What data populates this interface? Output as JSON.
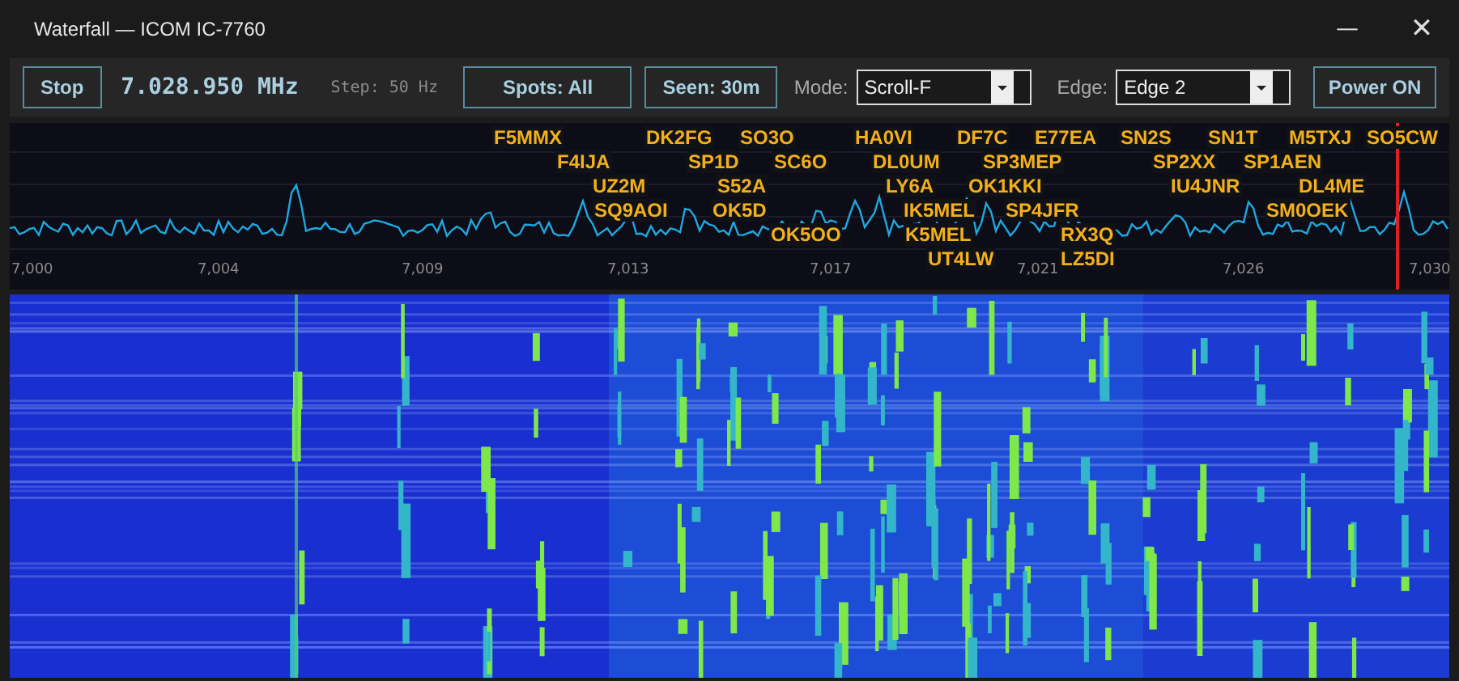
{
  "window": {
    "title": "Waterfall — ICOM IC-7760",
    "controls": [
      "—",
      "✕"
    ]
  },
  "toolbar": {
    "stop_button": "Stop",
    "frequency": "7.028.950 MHz",
    "step": "Step: 50 Hz",
    "spots_button": "Spots: All",
    "seen_button": "Seen: 30m",
    "mode_label": "Mode:",
    "mode_value": "Scroll-F",
    "edge_label": "Edge:",
    "edge_value": "Edge 2",
    "power_button": "Power ON"
  },
  "spectrum": {
    "ticks": [
      "7,000",
      "7,004",
      "7,009",
      "7,013",
      "7,017",
      "7,021",
      "7,026",
      "7,030"
    ],
    "spots": [
      {
        "call": "F5MMX"
      },
      {
        "call": "DK2FG"
      },
      {
        "call": "SO3O"
      },
      {
        "call": "HA0VI"
      },
      {
        "call": "DF7C"
      },
      {
        "call": "E77EA"
      },
      {
        "call": "SN2S"
      },
      {
        "call": "SN1T"
      },
      {
        "call": "M5TXJ"
      },
      {
        "call": "SO5CW"
      },
      {
        "call": "F4IJA"
      },
      {
        "call": "SP1D"
      },
      {
        "call": "SC6O"
      },
      {
        "call": "DL0UM"
      },
      {
        "call": "SP3MEP"
      },
      {
        "call": "SP2XX"
      },
      {
        "call": "SP1AEN"
      },
      {
        "call": "UZ2M"
      },
      {
        "call": "S52A"
      },
      {
        "call": "LY6A"
      },
      {
        "call": "OK1KKI"
      },
      {
        "call": "IU4JNR"
      },
      {
        "call": "DL4ME"
      },
      {
        "call": "SQ9AOI"
      },
      {
        "call": "OK5D"
      },
      {
        "call": "IK5MEL"
      },
      {
        "call": "SP4JFR"
      },
      {
        "call": "SM0OEK"
      },
      {
        "call": "OK5OO"
      },
      {
        "call": "K5MEL"
      },
      {
        "call": "RX3Q"
      },
      {
        "call": "UT4LW"
      },
      {
        "call": "LZ5DI"
      }
    ]
  }
}
